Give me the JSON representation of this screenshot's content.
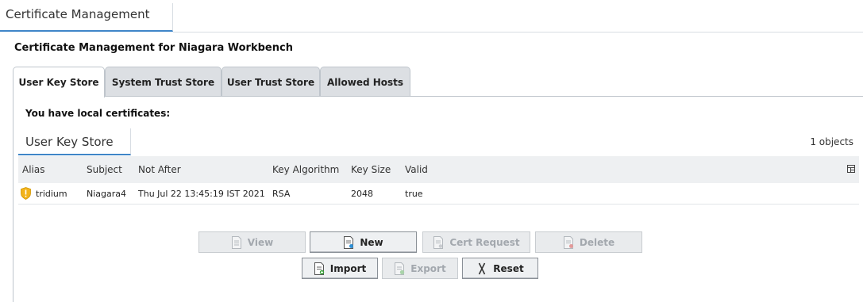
{
  "view": {
    "tab_label": "Certificate Management"
  },
  "page": {
    "title": "Certificate Management for Niagara Workbench"
  },
  "tabs": [
    {
      "label": "User Key Store",
      "active": true
    },
    {
      "label": "System Trust Store",
      "active": false
    },
    {
      "label": "User Trust Store",
      "active": false
    },
    {
      "label": "Allowed Hosts",
      "active": false
    }
  ],
  "content": {
    "heading": "You have local certificates:"
  },
  "store": {
    "label": "User Key Store",
    "count": "1 objects"
  },
  "table": {
    "columns": [
      "Alias",
      "Subject",
      "Not After",
      "Key Algorithm",
      "Key Size",
      "Valid"
    ],
    "rows": [
      {
        "alias": "tridium",
        "subject": "Niagara4",
        "not_after": "Thu Jul 22 13:45:19 IST 2021",
        "key_algorithm": "RSA",
        "key_size": "2048",
        "valid": "true"
      }
    ]
  },
  "buttons": {
    "view": "View",
    "new": "New",
    "cert_request": "Cert Request",
    "delete": "Delete",
    "import": "Import",
    "export": "Export",
    "reset": "Reset"
  },
  "colors": {
    "accent": "#3f86c8",
    "shield": "#f2b31b",
    "tab_bg": "#dcdfe3"
  },
  "icons": {
    "table_menu": "column-chooser-icon",
    "row": "shield-warning-icon",
    "view": "document-icon",
    "new": "new-document-icon",
    "cert_request": "certificate-request-icon",
    "delete": "delete-document-icon",
    "import": "import-document-icon",
    "export": "export-document-icon",
    "reset": "reset-icon"
  }
}
